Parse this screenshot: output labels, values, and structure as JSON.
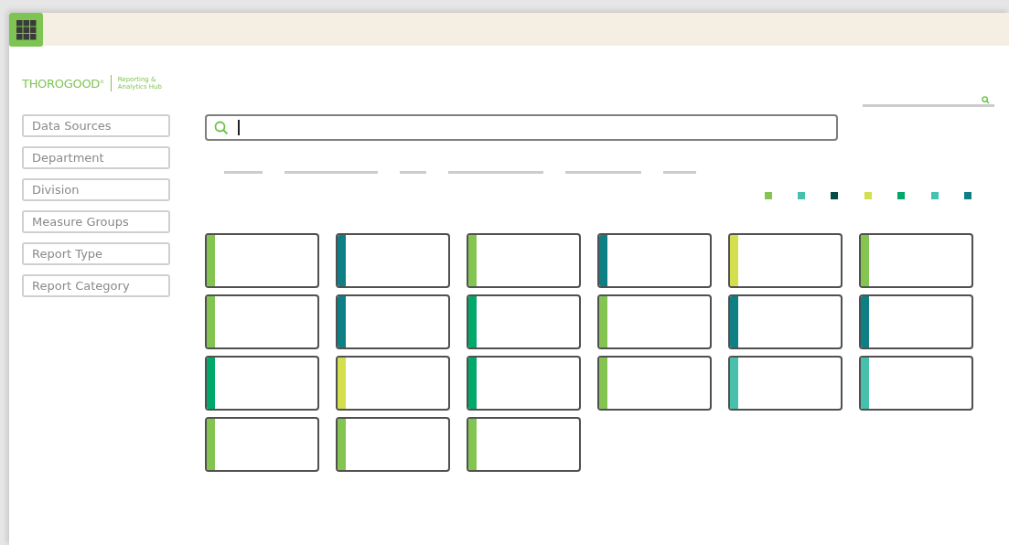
{
  "brand": {
    "logo": "THOROGOOD",
    "registered": "®",
    "subtitle_line_1": "Reporting &",
    "subtitle_line_2": "Analytics Hub"
  },
  "filters": [
    "Data Sources",
    "Department",
    "Division",
    "Measure Groups",
    "Report Type",
    "Report Category"
  ],
  "legend": [
    {
      "color": "#84c552"
    },
    {
      "color": "#47c1ac"
    },
    {
      "color": "#004d47"
    },
    {
      "color": "#d4df4d"
    },
    {
      "color": "#00a86b"
    },
    {
      "color": "#45c2b0"
    },
    {
      "color": "#0e7f85"
    }
  ],
  "cards": [
    {
      "color": "#84c552"
    },
    {
      "color": "#0e7f85"
    },
    {
      "color": "#84c552"
    },
    {
      "color": "#0e7f85"
    },
    {
      "color": "#d4df4d"
    },
    {
      "color": "#84c552"
    },
    {
      "color": "#84c552"
    },
    {
      "color": "#0e7f85"
    },
    {
      "color": "#00a86b"
    },
    {
      "color": "#84c552"
    },
    {
      "color": "#0e7f85"
    },
    {
      "color": "#0e7f85"
    },
    {
      "color": "#00a86b"
    },
    {
      "color": "#d4df4d"
    },
    {
      "color": "#00a86b"
    },
    {
      "color": "#84c552"
    },
    {
      "color": "#47c1ac"
    },
    {
      "color": "#47c1ac"
    },
    {
      "color": "#84c552"
    },
    {
      "color": "#84c552"
    },
    {
      "color": "#84c552"
    }
  ]
}
